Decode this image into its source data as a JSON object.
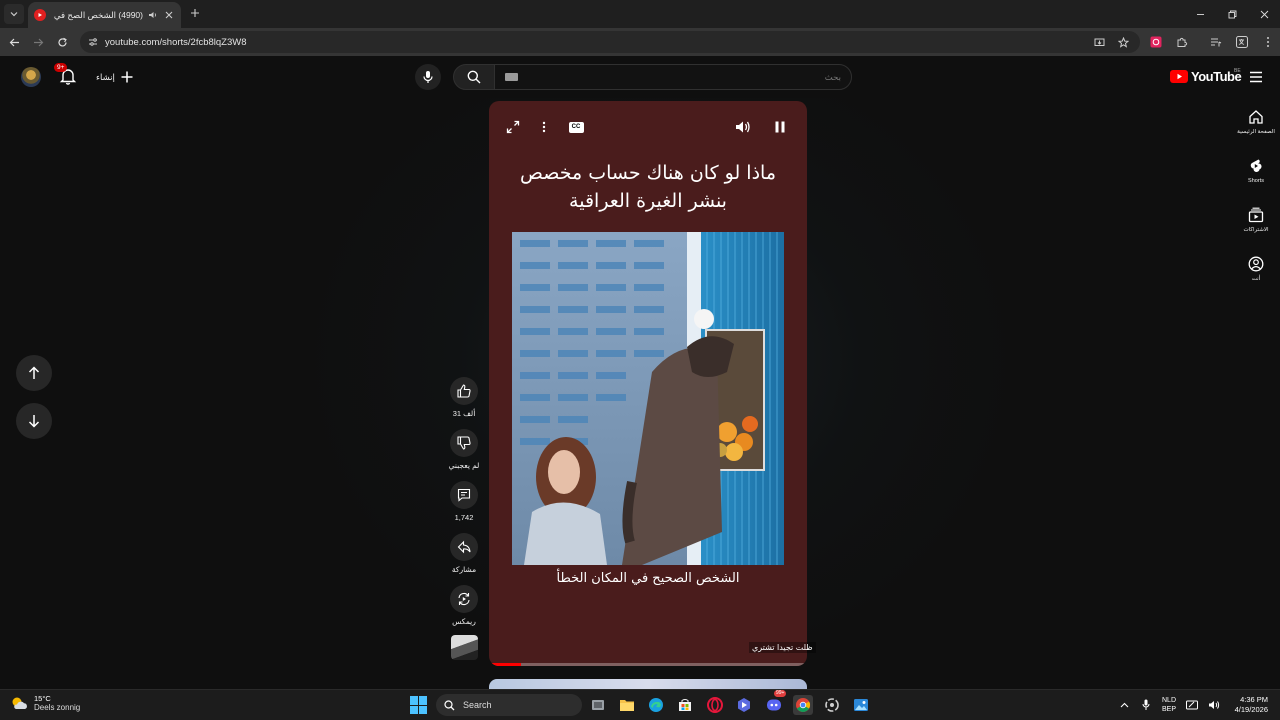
{
  "browser": {
    "tab": {
      "title": "(4990) الشخص الصح في مكا",
      "favicon": "youtube-favicon"
    },
    "url": "youtube.com/shorts/2fcb8lqZ3W8"
  },
  "masthead": {
    "notification_count": "9+",
    "create_label": "إنشاء",
    "search_placeholder": "بحث",
    "logo_text": "YouTube",
    "country_code": "BE"
  },
  "guide": {
    "items": [
      {
        "label": "الصفحة الرئيسية",
        "icon": "home-icon"
      },
      {
        "label": "Shorts",
        "icon": "shorts-icon"
      },
      {
        "label": "الاشتراكات",
        "icon": "subscriptions-icon"
      },
      {
        "label": "أنت",
        "icon": "you-icon"
      }
    ]
  },
  "short": {
    "headline": "ماذا لو كان هناك حساب مخصص بنشر الغيرة العراقية",
    "caption": "الشخص الصحيح في المكان الخطأ",
    "channel_credit": "ظلت تجيدا تشتري",
    "progress": 0.1
  },
  "actions": {
    "like_count": "31 ألف",
    "dislike_label": "لم يعجبني",
    "comment_count": "1,742",
    "share_label": "مشاركة",
    "remix_label": "ريمكس"
  },
  "taskbar": {
    "weather_temp": "15°C",
    "weather_desc": "Deels zonnig",
    "search_label": "Search",
    "lang_top": "NLD",
    "lang_bottom": "BEP",
    "time": "4:36 PM",
    "date": "4/19/2026",
    "app_badge": "99+"
  },
  "colors": {
    "player_bg": "#4a1c1c",
    "accent_red": "#ff0000",
    "page_bg": "#0f0f0f"
  }
}
